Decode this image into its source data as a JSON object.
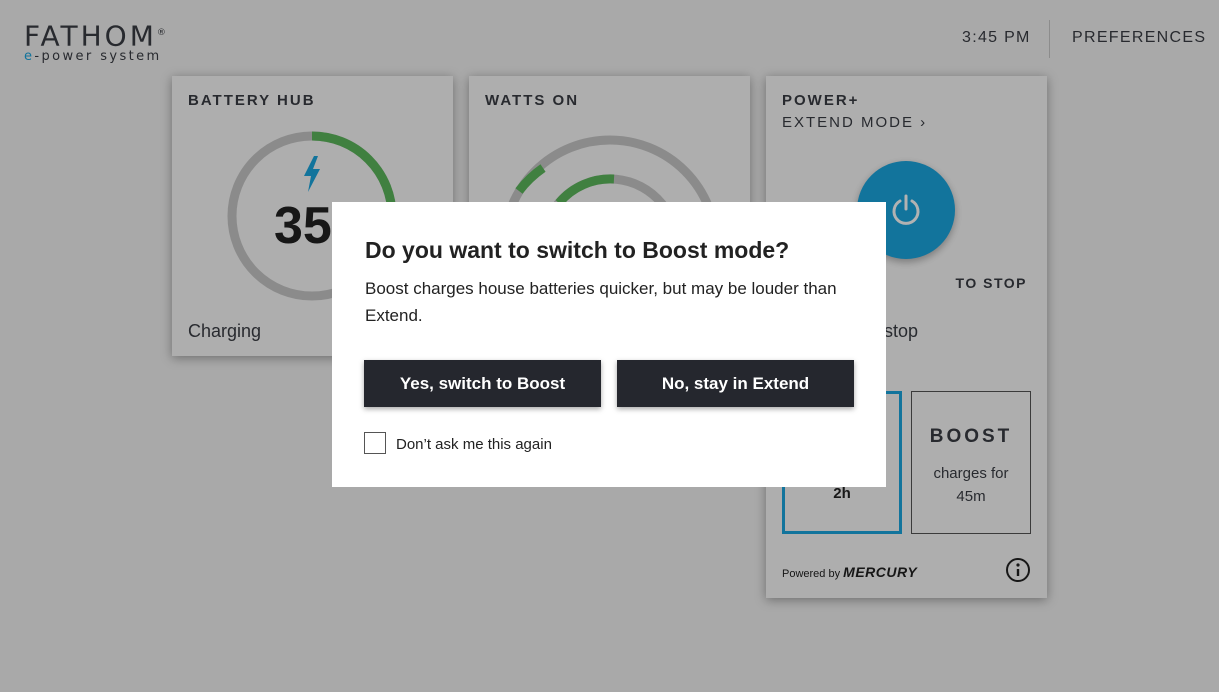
{
  "header": {
    "logo_main": "FATHOM",
    "logo_mark": "®",
    "logo_sub_e": "e",
    "logo_sub_rest": "-power system",
    "time": "3:45 PM",
    "preferences_label": "PREFERENCES"
  },
  "battery_hub": {
    "title": "BATTERY HUB",
    "value": "35",
    "status": "Charging"
  },
  "watts_on": {
    "title": "WATTS ON"
  },
  "power_plus": {
    "title": "POWER+",
    "mode_link": "EXTEND MODE ›",
    "tap_text": "TO STOP",
    "status_fragment": "-stop",
    "extend_time": "2h",
    "boost_label": "BOOST",
    "boost_desc_line1": "charges for",
    "boost_desc_line2": "45m",
    "powered_by": "Powered by",
    "brand": "MERCURY"
  },
  "dialog": {
    "title": "Do you want to switch to Boost mode?",
    "body": "Boost charges house batteries quicker, but may be louder than Extend.",
    "yes_label": "Yes, switch to Boost",
    "no_label": "No, stay in Extend",
    "checkbox_label": "Don’t ask me this again",
    "checkbox_checked": false
  },
  "colors": {
    "accent": "#1aa6e0",
    "gauge_green": "#5cb85c",
    "gauge_track": "#c8c8c8",
    "button_dark": "#25272e"
  },
  "icons": {
    "bolt": "lightning-bolt-icon",
    "power": "power-icon",
    "info": "info-icon"
  }
}
